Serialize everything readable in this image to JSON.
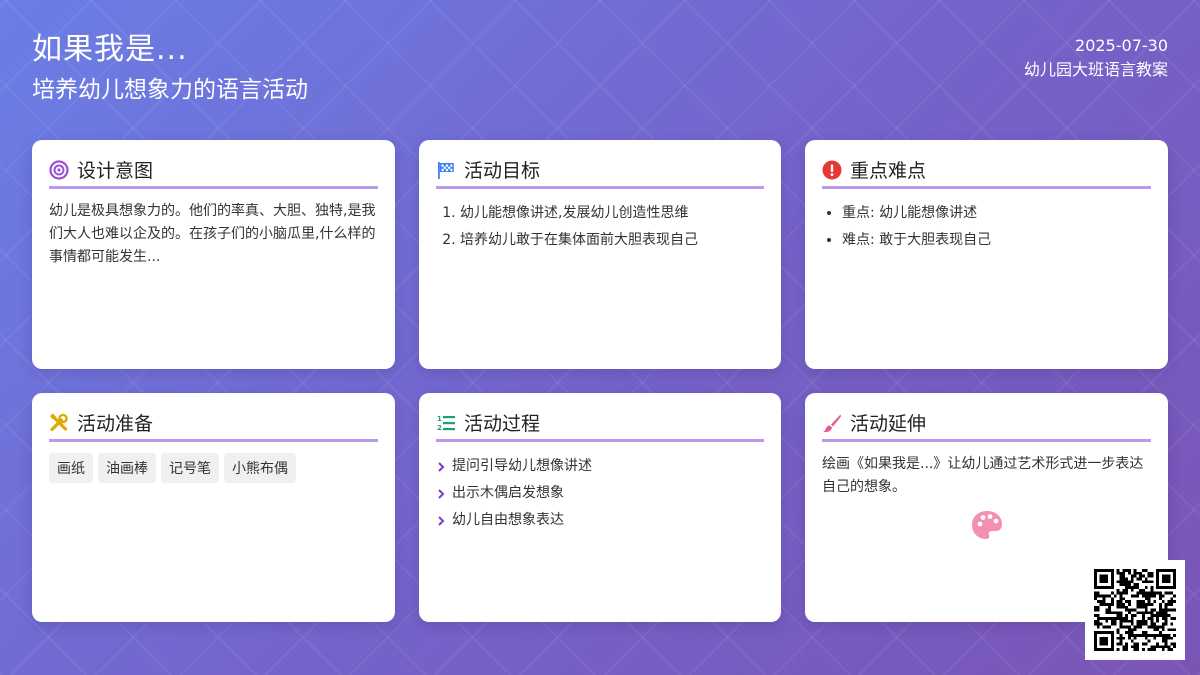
{
  "header": {
    "title": "如果我是...",
    "subtitle": "培养幼儿想象力的语言活动",
    "date": "2025-07-30",
    "category": "幼儿园大班语言教案"
  },
  "cards": {
    "design": {
      "icon": "target-icon",
      "title": "设计意图",
      "text": "幼儿是极具想象力的。他们的率真、大胆、独特,是我们大人也难以企及的。在孩子们的小脑瓜里,什么样的事情都可能发生..."
    },
    "goals": {
      "icon": "flag-icon",
      "title": "活动目标",
      "items": [
        "幼儿能想像讲述,发展幼儿创造性思维",
        "培养幼儿敢于在集体面前大胆表现自己"
      ]
    },
    "key_points": {
      "icon": "exclamation-icon",
      "title": "重点难点",
      "items": [
        "重点: 幼儿能想像讲述",
        "难点: 敢于大胆表现自己"
      ]
    },
    "prep": {
      "icon": "tools-icon",
      "title": "活动准备",
      "tags": [
        "画纸",
        "油画棒",
        "记号笔",
        "小熊布偶"
      ]
    },
    "process": {
      "icon": "numbered-list-icon",
      "title": "活动过程",
      "steps": [
        "提问引导幼儿想像讲述",
        "出示木偶启发想象",
        "幼儿自由想象表达"
      ]
    },
    "extension": {
      "icon": "paintbrush-icon",
      "title": "活动延伸",
      "text": "绘画《如果我是...》让幼儿通过艺术形式进一步表达自己的想象。"
    }
  },
  "colors": {
    "accent_line": "#b99af0",
    "target_icon": "#9b4fd1",
    "flag_icon": "#3b82f6",
    "alert_icon": "#e53935",
    "tools_icon": "#e0a800",
    "list_icon": "#22a06b",
    "brush_icon": "#e75a9a",
    "palette_icon": "#f48fb1"
  }
}
